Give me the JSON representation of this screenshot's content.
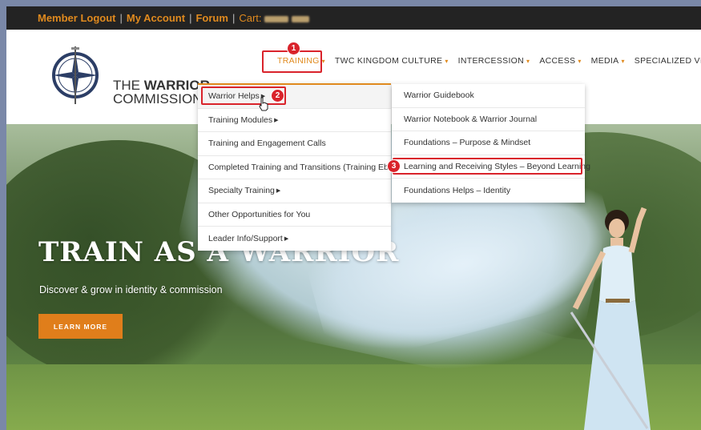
{
  "topbar": {
    "member_logout": "Member Logout",
    "sep1": "|",
    "my_account": "My Account",
    "sep2": "|",
    "forum": "Forum",
    "sep3": "|",
    "cart_label": "Cart:"
  },
  "logo": {
    "line1_prefix": "THE",
    "line1_bold": "WARRIOR",
    "line2": "COMMISSION"
  },
  "nav": {
    "items": [
      {
        "label": "TRAINING"
      },
      {
        "label": "TWC KINGDOM CULTURE"
      },
      {
        "label": "INTERCESSION"
      },
      {
        "label": "ACCESS"
      },
      {
        "label": "MEDIA"
      },
      {
        "label": "SPECIALIZED VIDEOS"
      }
    ]
  },
  "training_menu": {
    "items": [
      {
        "label": "Warrior Helps"
      },
      {
        "label": "Training Modules"
      },
      {
        "label": "Training and Engagement Calls"
      },
      {
        "label": "Completed Training and Transitions (Training Ebb)"
      },
      {
        "label": "Specialty Training"
      },
      {
        "label": "Other Opportunities for You"
      },
      {
        "label": "Leader Info/Support"
      }
    ]
  },
  "warrior_helps_menu": {
    "items": [
      {
        "label": "Warrior Guidebook"
      },
      {
        "label": "Warrior Notebook & Warrior Journal"
      },
      {
        "label": "Foundations – Purpose & Mindset"
      },
      {
        "label": "Learning and Receiving Styles – Beyond Learning"
      },
      {
        "label": "Foundations Helps – Identity"
      }
    ]
  },
  "hero": {
    "title": "TRAIN AS A WARRIOR",
    "subtitle": "Discover & grow in identity & commission",
    "button": "LEARN MORE"
  },
  "annotations": {
    "badge1": "1",
    "badge2": "2",
    "badge3": "3"
  },
  "colors": {
    "accent": "#e08a1e",
    "highlight": "#d9232b",
    "topbar_bg": "#232323"
  }
}
